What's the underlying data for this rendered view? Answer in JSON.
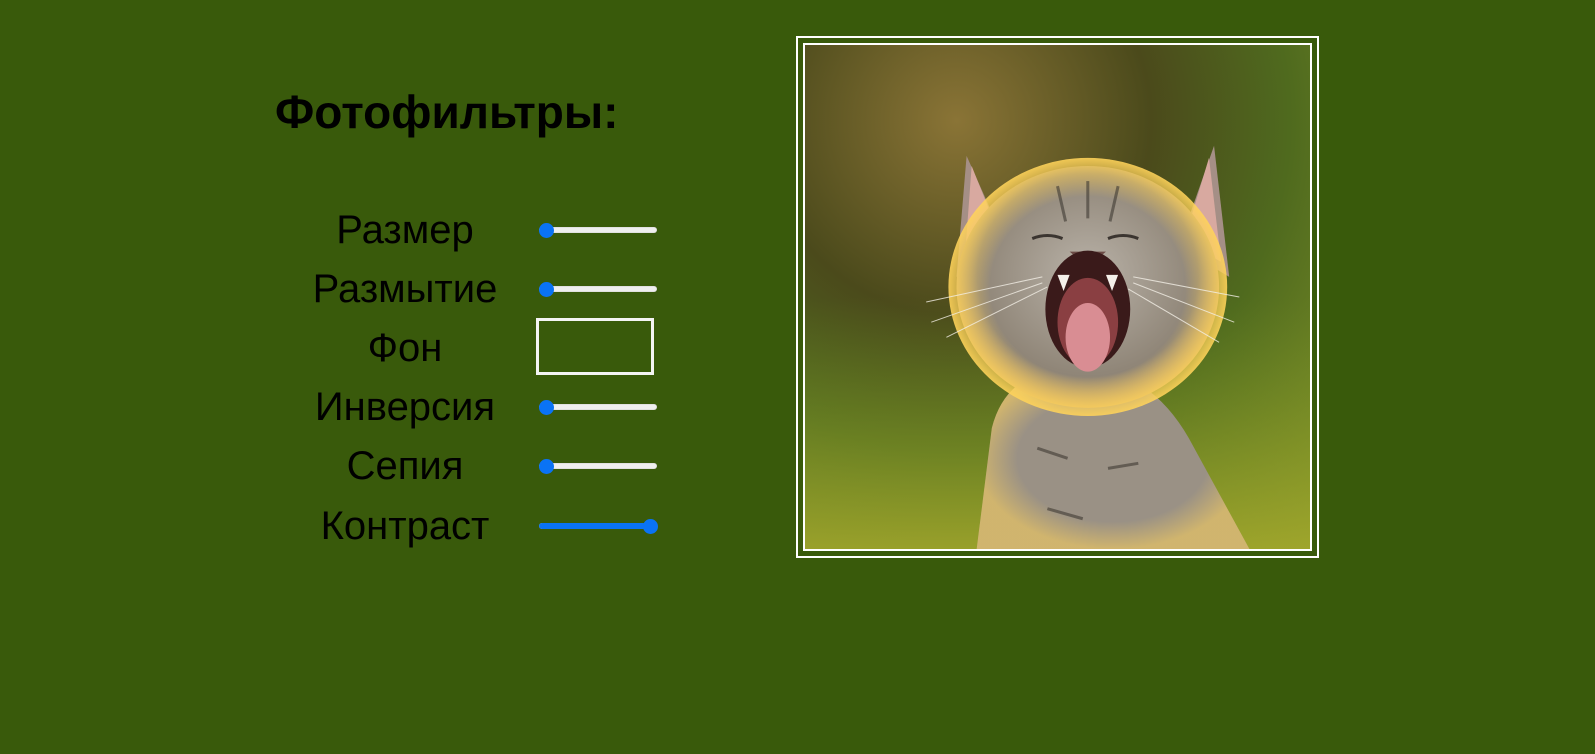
{
  "title": "Фотофильтры:",
  "filters": [
    {
      "label": "Размер",
      "type": "range",
      "value": 0.0
    },
    {
      "label": "Размытие",
      "type": "range",
      "value": 0.0
    },
    {
      "label": "Фон",
      "type": "color",
      "value": "#395a0b"
    },
    {
      "label": "Инверсия",
      "type": "range",
      "value": 0.0
    },
    {
      "label": "Сепия",
      "type": "range",
      "value": 0.0
    },
    {
      "label": "Контраст",
      "type": "range",
      "value": 1.0
    }
  ],
  "colors": {
    "background": "#395a0b",
    "accent": "#0a73f5",
    "frame": "#ffffff"
  },
  "image": {
    "subject": "yawning kitten photo"
  }
}
